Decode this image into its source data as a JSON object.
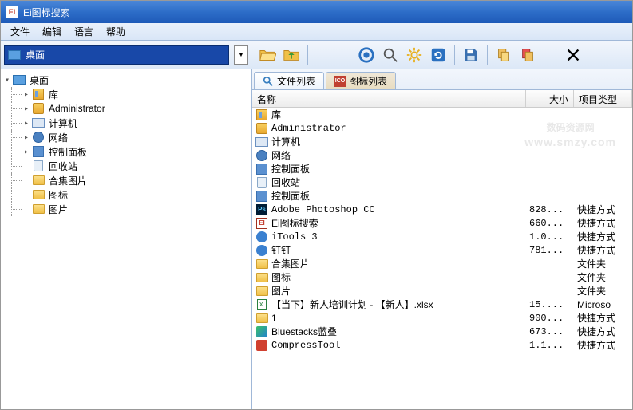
{
  "app": {
    "title": "Ei图标搜索"
  },
  "menu": {
    "file": "文件",
    "edit": "编辑",
    "language": "语言",
    "help": "帮助"
  },
  "toolbar": {
    "path_label": "桌面"
  },
  "tree": {
    "root": "桌面",
    "items": [
      {
        "label": "库",
        "icon": "lib"
      },
      {
        "label": "Administrator",
        "icon": "user"
      },
      {
        "label": "计算机",
        "icon": "computer"
      },
      {
        "label": "网络",
        "icon": "network"
      },
      {
        "label": "控制面板",
        "icon": "cpanel"
      },
      {
        "label": "回收站",
        "icon": "recycle"
      },
      {
        "label": "合集图片",
        "icon": "folder"
      },
      {
        "label": "图标",
        "icon": "folder"
      },
      {
        "label": "图片",
        "icon": "folder"
      }
    ]
  },
  "tabs": {
    "files": "文件列表",
    "icons": "图标列表"
  },
  "columns": {
    "name": "名称",
    "size": "大小",
    "type": "项目类型"
  },
  "rows": [
    {
      "name": "库",
      "size": "",
      "type": "",
      "icon": "lib"
    },
    {
      "name": "Administrator",
      "size": "",
      "type": "",
      "icon": "user"
    },
    {
      "name": "计算机",
      "size": "",
      "type": "",
      "icon": "computer"
    },
    {
      "name": "网络",
      "size": "",
      "type": "",
      "icon": "network"
    },
    {
      "name": "控制面板",
      "size": "",
      "type": "",
      "icon": "cpanel"
    },
    {
      "name": "回收站",
      "size": "",
      "type": "",
      "icon": "recycle"
    },
    {
      "name": "控制面板",
      "size": "",
      "type": "",
      "icon": "cpanel"
    },
    {
      "name": "Adobe Photoshop CC",
      "size": "828...",
      "type": "快捷方式",
      "icon": "ps"
    },
    {
      "name": "Ei图标搜索",
      "size": "660...",
      "type": "快捷方式",
      "icon": "ei"
    },
    {
      "name": "iTools 3",
      "size": "1.0...",
      "type": "快捷方式",
      "icon": "blue"
    },
    {
      "name": "钉钉",
      "size": "781...",
      "type": "快捷方式",
      "icon": "blue"
    },
    {
      "name": "合集图片",
      "size": "",
      "type": "文件夹",
      "icon": "folder"
    },
    {
      "name": "图标",
      "size": "",
      "type": "文件夹",
      "icon": "folder"
    },
    {
      "name": "图片",
      "size": "",
      "type": "文件夹",
      "icon": "folder"
    },
    {
      "name": "【当下】新人培训计划 - 【新人】.xlsx",
      "size": "15....",
      "type": "Microso",
      "icon": "xlsx"
    },
    {
      "name": "1",
      "size": "900...",
      "type": "快捷方式",
      "icon": "folder"
    },
    {
      "name": "Bluestacks蓝叠",
      "size": "673...",
      "type": "快捷方式",
      "icon": "bs"
    },
    {
      "name": "CompressTool",
      "size": "1.1...",
      "type": "快捷方式",
      "icon": "comp"
    }
  ],
  "watermark": {
    "text": "数码资源网",
    "url": "www.smzy.com"
  }
}
